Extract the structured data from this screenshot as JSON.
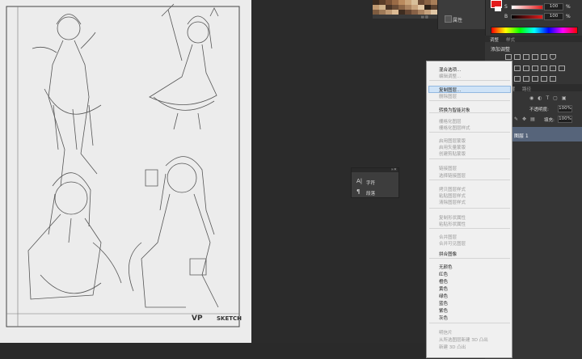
{
  "properties_panel": {
    "label": "属性"
  },
  "color_panel": {
    "channels": [
      {
        "label": "S",
        "value": "100",
        "unit": "%"
      },
      {
        "label": "B",
        "value": "100",
        "unit": "%"
      }
    ],
    "fg_color": "#e31c1c",
    "bg_color": "#ffffff"
  },
  "adjustments_panel": {
    "tabs": [
      "调整",
      "样式"
    ],
    "title": "添加调整"
  },
  "layers_panel": {
    "tabs": [
      "图层",
      "路径"
    ],
    "blend_mode": "不透明度:",
    "opacity": "100%",
    "fill_label": "填充:",
    "fill": "100%",
    "layer_name": "图层 1"
  },
  "character_panel": {
    "items": [
      {
        "icon": "A|",
        "label": "字符"
      },
      {
        "icon": "¶",
        "label": "段落"
      }
    ]
  },
  "context_menu": {
    "items": [
      {
        "label": "混合选项...",
        "enabled": true
      },
      {
        "label": "编辑调整...",
        "enabled": false
      },
      {
        "label": "复制图层...",
        "enabled": true,
        "highlighted": true
      },
      {
        "label": "删除图层",
        "enabled": false
      },
      {
        "label": "转换为智能对象",
        "enabled": true
      },
      {
        "label": "栅格化图层",
        "enabled": false
      },
      {
        "label": "栅格化图层样式",
        "enabled": false
      },
      {
        "label": "启用图层蒙版",
        "enabled": false
      },
      {
        "label": "启用矢量蒙版",
        "enabled": false
      },
      {
        "label": "创建剪贴蒙版",
        "enabled": false
      },
      {
        "label": "链接图层",
        "enabled": false
      },
      {
        "label": "选择链接图层",
        "enabled": false
      },
      {
        "label": "拷贝图层样式",
        "enabled": false
      },
      {
        "label": "粘贴图层样式",
        "enabled": false
      },
      {
        "label": "清除图层样式",
        "enabled": false
      },
      {
        "label": "复制形状属性",
        "enabled": false
      },
      {
        "label": "粘贴形状属性",
        "enabled": false
      },
      {
        "label": "合并图层",
        "enabled": false
      },
      {
        "label": "合并可见图层",
        "enabled": false
      },
      {
        "label": "拼合图像",
        "enabled": true
      },
      {
        "label": "无颜色",
        "enabled": true
      },
      {
        "label": "红色",
        "enabled": true
      },
      {
        "label": "橙色",
        "enabled": true
      },
      {
        "label": "黄色",
        "enabled": true
      },
      {
        "label": "绿色",
        "enabled": true
      },
      {
        "label": "蓝色",
        "enabled": true
      },
      {
        "label": "紫色",
        "enabled": true
      },
      {
        "label": "灰色",
        "enabled": true
      },
      {
        "label": "明信片",
        "enabled": false
      },
      {
        "label": "从所选图层新建 3D 凸出",
        "enabled": false
      },
      {
        "label": "新建 3D 凸出",
        "enabled": false
      }
    ]
  },
  "canvas": {
    "watermark_text": "SKETCH",
    "logo_text": "VP"
  }
}
